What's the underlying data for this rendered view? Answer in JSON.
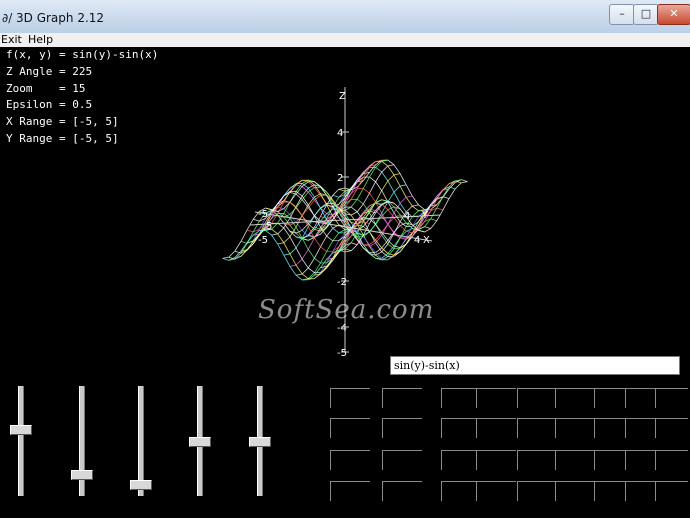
{
  "window": {
    "title": "3D Graph 2.12",
    "icon_text": "∂/",
    "minimize_glyph": "–",
    "maximize_glyph": "□",
    "close_glyph": "✕"
  },
  "menu": {
    "exit": "Exit",
    "help": "Help"
  },
  "info": {
    "function": "f(x, y) = sin(y)-sin(x)",
    "z_angle": "Z Angle = 225",
    "zoom": "Zoom    = 15",
    "epsilon": "Epsilon = 0.5",
    "x_range": "X Range = [-5, 5]",
    "y_range": "Y Range = [-5, 5]"
  },
  "formula": {
    "value": "sin(y)-sin(x)"
  },
  "plot": {
    "z_axis_label": "Z",
    "x_axis_label": "X",
    "y_axis_label": "Y",
    "z_ticks": [
      "4",
      "2",
      "-2",
      "-4",
      "-5"
    ],
    "x_ticks": [
      "-5",
      "4"
    ],
    "y_ticks": [
      "-5",
      "5",
      "4"
    ],
    "x_range": [
      -5,
      5
    ],
    "y_range": [
      -5,
      5
    ],
    "z_angle_deg": 225,
    "zoom": 15
  },
  "sliders": [
    {
      "name": "slider-1",
      "value": 0.38
    },
    {
      "name": "slider-2",
      "value": 0.82
    },
    {
      "name": "slider-3",
      "value": 0.92
    },
    {
      "name": "slider-4",
      "value": 0.5
    },
    {
      "name": "slider-5",
      "value": 0.5
    }
  ],
  "watermark": "SoftSea.com",
  "colors": {
    "background": "#000000",
    "text": "#ffffff",
    "axis": "#cccccc"
  }
}
